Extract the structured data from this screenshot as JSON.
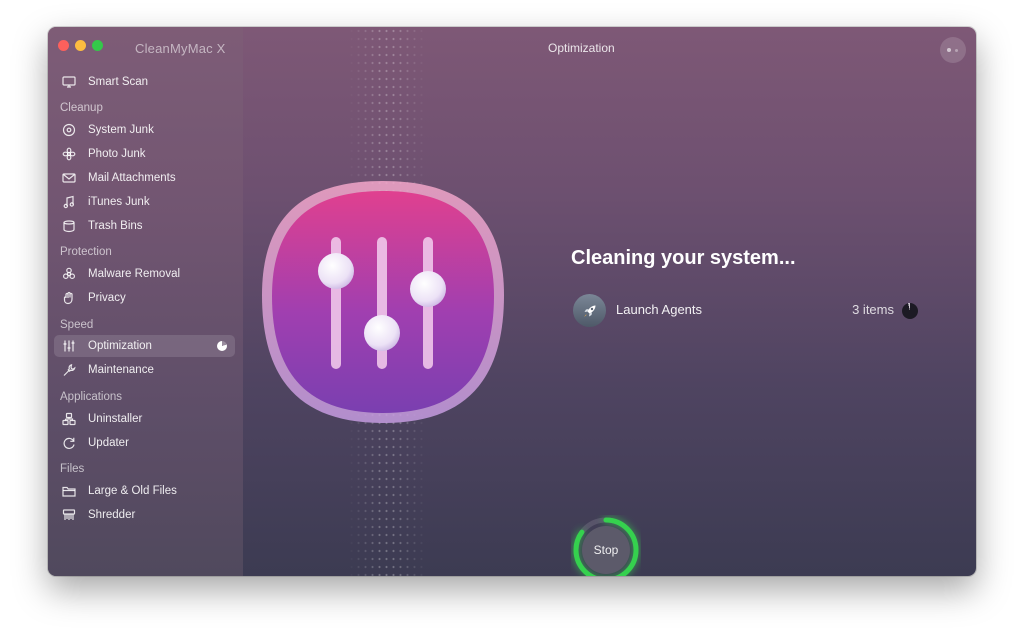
{
  "window": {
    "app_title": "CleanMyMac X",
    "title": "Optimization"
  },
  "sidebar": {
    "smart_scan": {
      "label": "Smart Scan",
      "icon": "monitor-icon"
    },
    "sections": {
      "cleanup": "Cleanup",
      "protection": "Protection",
      "speed": "Speed",
      "applications": "Applications",
      "files": "Files"
    },
    "items": {
      "system_junk": {
        "label": "System Junk",
        "icon": "disc-icon"
      },
      "photo_junk": {
        "label": "Photo Junk",
        "icon": "flower-icon"
      },
      "mail_attachments": {
        "label": "Mail Attachments",
        "icon": "envelope-icon"
      },
      "itunes_junk": {
        "label": "iTunes Junk",
        "icon": "music-note-icon"
      },
      "trash_bins": {
        "label": "Trash Bins",
        "icon": "trash-icon"
      },
      "malware_removal": {
        "label": "Malware Removal",
        "icon": "biohazard-icon"
      },
      "privacy": {
        "label": "Privacy",
        "icon": "hand-icon"
      },
      "optimization": {
        "label": "Optimization",
        "icon": "sliders-icon",
        "active": true
      },
      "maintenance": {
        "label": "Maintenance",
        "icon": "wrench-icon"
      },
      "uninstaller": {
        "label": "Uninstaller",
        "icon": "uninstaller-icon"
      },
      "updater": {
        "label": "Updater",
        "icon": "updater-icon"
      },
      "large_old_files": {
        "label": "Large & Old Files",
        "icon": "folder-icon"
      },
      "shredder": {
        "label": "Shredder",
        "icon": "shredder-icon"
      }
    }
  },
  "main": {
    "heading": "Cleaning your system...",
    "task": {
      "label": "Launch Agents",
      "count": "3 items",
      "icon": "rocket-icon"
    },
    "stop_label": "Stop",
    "progress": 0.85
  },
  "colors": {
    "accent_green": "#35d14e",
    "icon_pink": "#e0408f",
    "icon_purple": "#7a3fb0"
  }
}
